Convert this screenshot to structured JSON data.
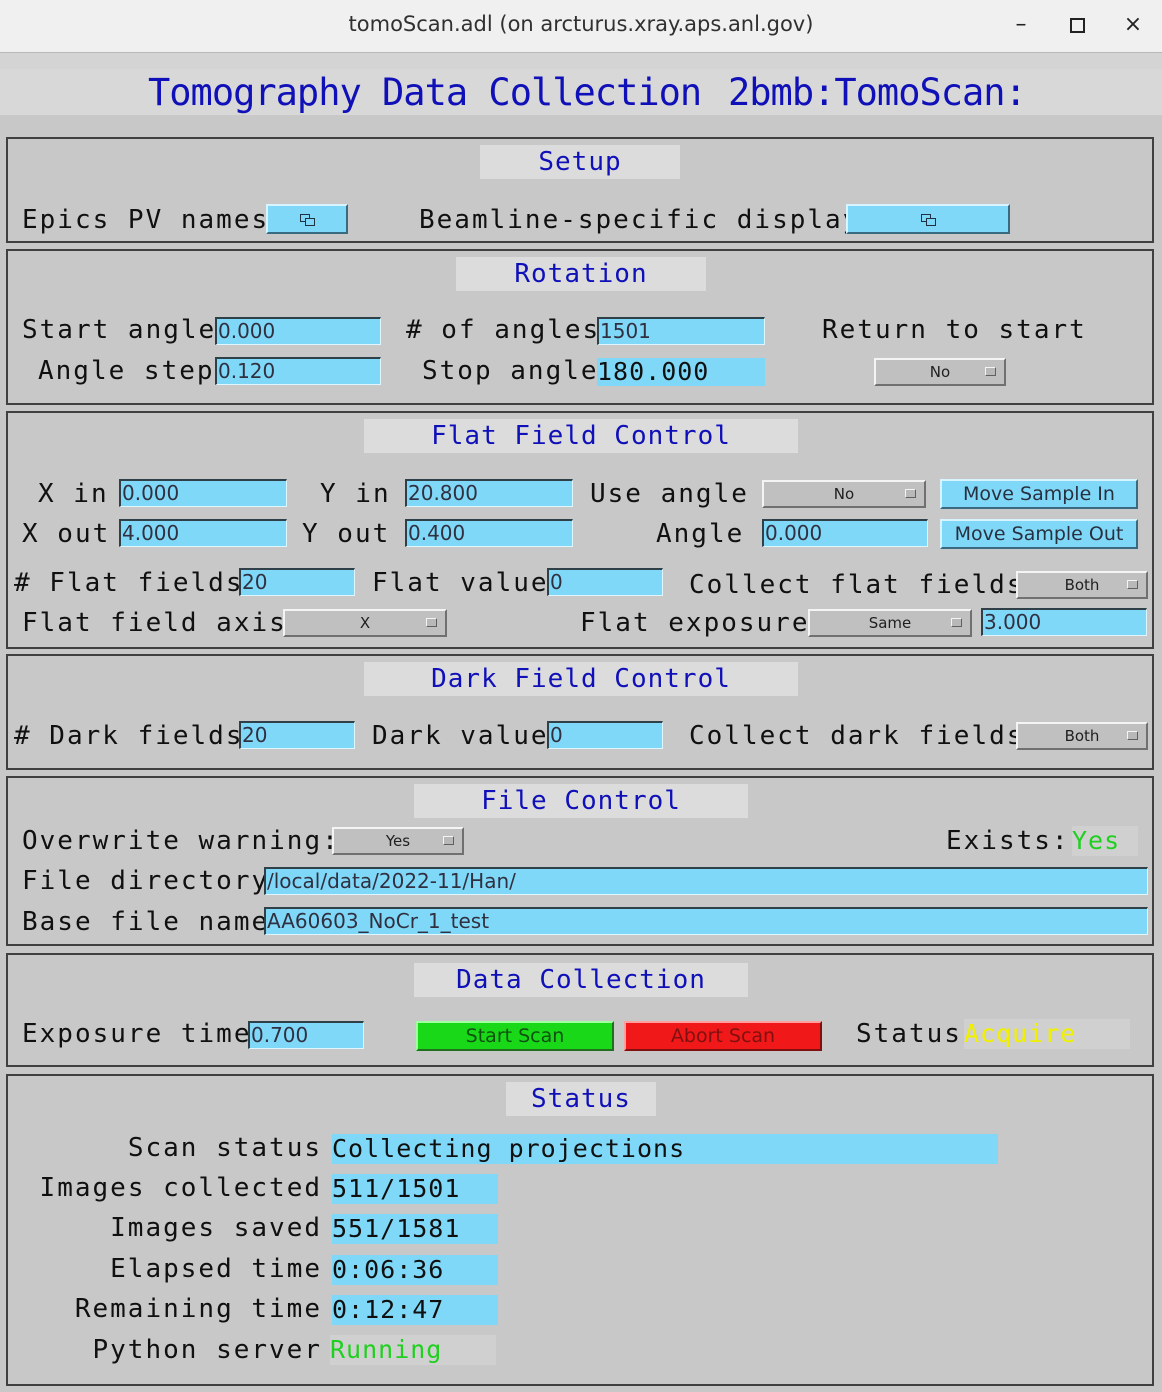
{
  "window": {
    "title": "tomoScan.adl (on arcturus.xray.aps.anl.gov)",
    "minimize": "–",
    "close": "×"
  },
  "header": {
    "title": "Tomography Data Collection",
    "prefix": "2bmb:TomoScan:"
  },
  "setup": {
    "title": "Setup",
    "epics_label": "Epics PV names",
    "beamline_label": "Beamline-specific display"
  },
  "rotation": {
    "title": "Rotation",
    "start_angle_label": "Start angle",
    "start_angle": "0.000",
    "num_angles_label": "# of angles",
    "num_angles": "1501",
    "return_label": "Return to start",
    "angle_step_label": "Angle step",
    "angle_step": "0.120",
    "stop_angle_label": "Stop angle",
    "stop_angle": "180.000",
    "return_value": "No"
  },
  "flat": {
    "title": "Flat Field Control",
    "x_in_label": "X in",
    "x_in": "0.000",
    "y_in_label": "Y in",
    "y_in": "20.800",
    "use_angle_label": "Use angle",
    "use_angle": "No",
    "move_in": "Move Sample In",
    "x_out_label": "X out",
    "x_out": "4.000",
    "y_out_label": "Y out",
    "y_out": "0.400",
    "angle_label": "Angle",
    "angle": "0.000",
    "move_out": "Move Sample Out",
    "num_label": "# Flat fields",
    "num": "20",
    "value_label": "Flat value",
    "value": "0",
    "collect_label": "Collect flat fields",
    "collect": "Both",
    "axis_label": "Flat field axis",
    "axis": "X",
    "exposure_label": "Flat exposure",
    "exposure_mode": "Same",
    "exposure": "3.000"
  },
  "dark": {
    "title": "Dark Field Control",
    "num_label": "# Dark fields",
    "num": "20",
    "value_label": "Dark value",
    "value": "0",
    "collect_label": "Collect dark fields",
    "collect": "Both"
  },
  "file": {
    "title": "File Control",
    "overwrite_label": "Overwrite warning:",
    "overwrite": "Yes",
    "exists_label": "Exists:",
    "exists": "Yes",
    "dir_label": "File directory",
    "dir": "/local/data/2022-11/Han/",
    "base_label": "Base file name",
    "base": "AA60603_NoCr_1_test"
  },
  "collect": {
    "title": "Data Collection",
    "exposure_label": "Exposure time",
    "exposure": "0.700",
    "start": "Start Scan",
    "abort": "Abort Scan",
    "status_label": "Status",
    "status": "Acquire"
  },
  "status": {
    "title": "Status",
    "scan_label": "Scan status",
    "scan": "Collecting projections",
    "images_collected_label": "Images collected",
    "images_collected": "511/1501",
    "images_saved_label": "Images saved",
    "images_saved": "551/1581",
    "elapsed_label": "Elapsed time",
    "elapsed": "0:06:36",
    "remaining_label": "Remaining time",
    "remaining": "0:12:47",
    "server_label": "Python server",
    "server": "Running"
  },
  "colors": {
    "title_blue": "#1010b8",
    "input_cyan": "#80d8f8",
    "ok_green": "#20d020",
    "acquire_yellow": "#f0f000"
  }
}
